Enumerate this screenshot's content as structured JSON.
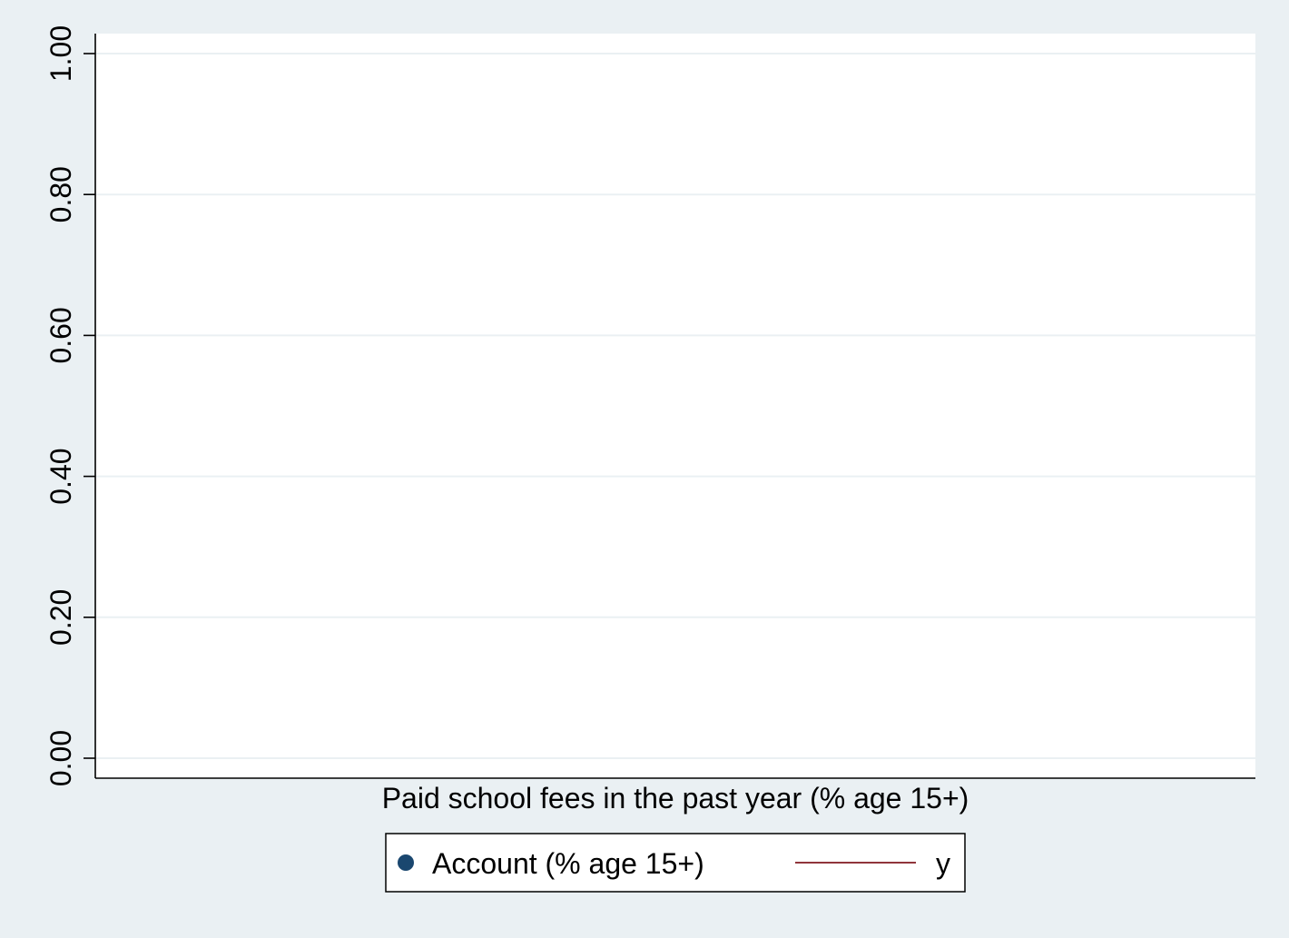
{
  "chart_data": {
    "type": "scatter",
    "title": "",
    "xlabel": "Paid school fees in the past year (% age 15+)",
    "ylabel": "",
    "ylim": [
      0,
      1
    ],
    "yticks": [
      {
        "value": 0.0,
        "label": "0.00"
      },
      {
        "value": 0.2,
        "label": "0.20"
      },
      {
        "value": 0.4,
        "label": "0.40"
      },
      {
        "value": 0.6,
        "label": "0.60"
      },
      {
        "value": 0.8,
        "label": "0.80"
      },
      {
        "value": 1.0,
        "label": "1.00"
      }
    ],
    "grid": true,
    "legend_position": "bottom",
    "series": [
      {
        "name": "Account (% age 15+)",
        "kind": "scatter",
        "marker": "circle",
        "color": "#1a476f",
        "points": []
      },
      {
        "name": "y",
        "kind": "line",
        "color": "#90353b",
        "points": []
      }
    ],
    "colors": {
      "background": "#eaf0f3",
      "plot_area": "#ffffff",
      "gridline": "#eaf0f3",
      "axis": "#000000"
    }
  }
}
